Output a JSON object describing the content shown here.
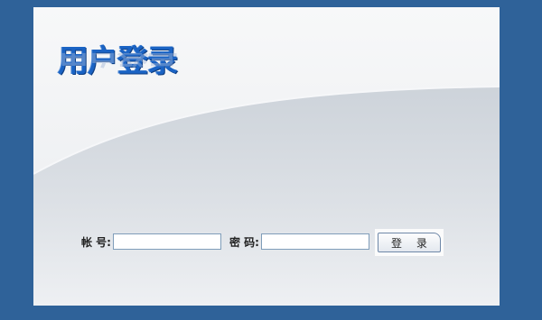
{
  "login": {
    "title": "用户登录",
    "username_label": "帐 号:",
    "username_value": "",
    "password_label": "密 码:",
    "password_value": "",
    "submit_label": "登 录"
  },
  "colors": {
    "frame": "#2f6299",
    "panel": "#f2f3f5",
    "wave": "#c9d0d8",
    "title": "#1a63c4"
  }
}
